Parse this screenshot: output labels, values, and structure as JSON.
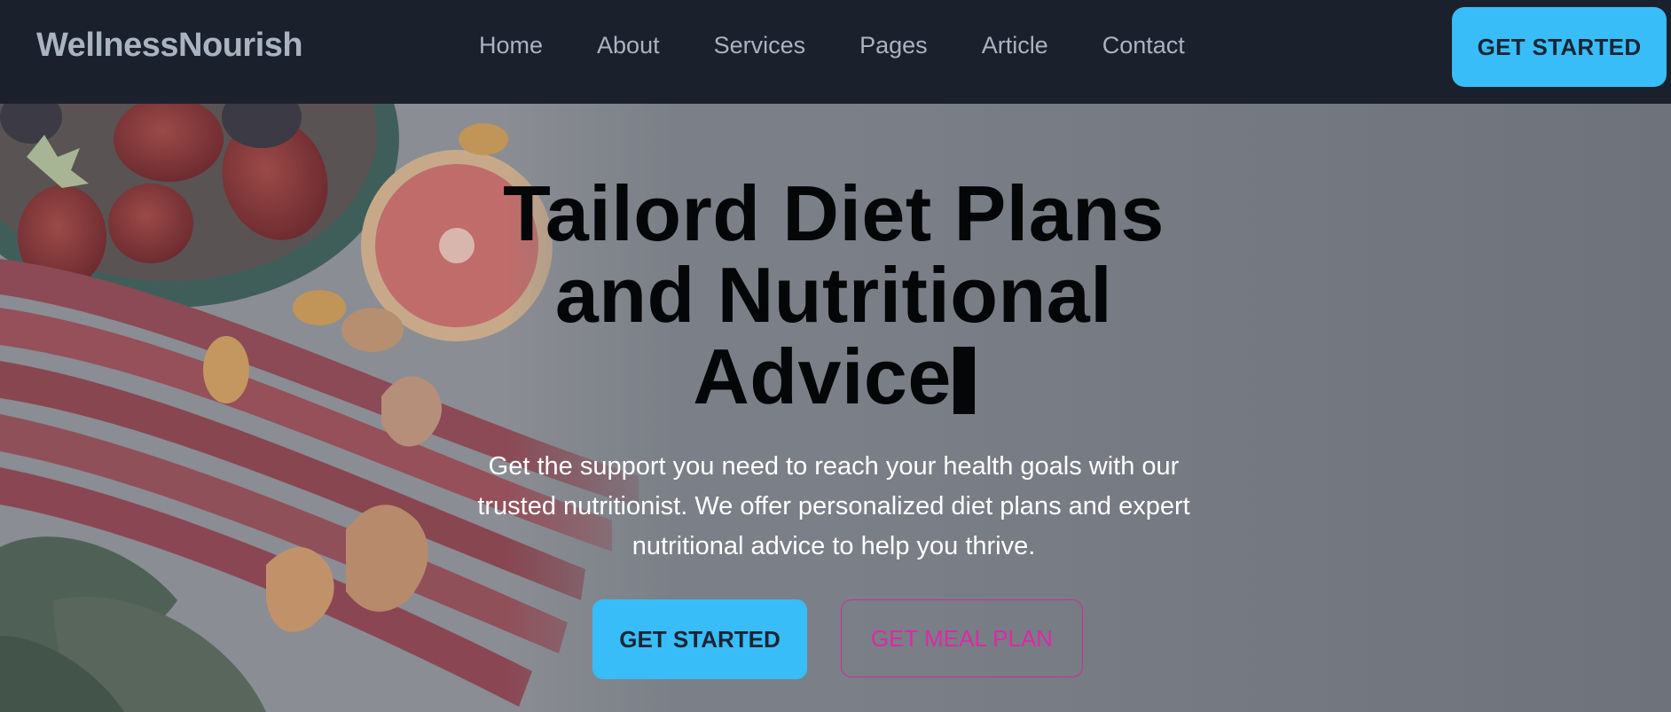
{
  "header": {
    "logo": "WellnessNourish",
    "nav": [
      {
        "label": "Home"
      },
      {
        "label": "About"
      },
      {
        "label": "Services"
      },
      {
        "label": "Pages"
      },
      {
        "label": "Article"
      },
      {
        "label": "Contact"
      }
    ],
    "cta_label": "GET STARTED"
  },
  "hero": {
    "title": "Tailord Diet Plans and Nutritional Advice",
    "subtitle": "Get the support you need to reach your health goals with our trusted nutritionist. We offer personalized diet plans and expert nutritional advice to help you thrive.",
    "primary_button": "GET STARTED",
    "secondary_button": "GET MEAL PLAN"
  },
  "colors": {
    "nav_bg": "#1b212c",
    "nav_text": "#a9b3c1",
    "accent": "#38bdf8",
    "secondary_accent": "#db2aa6",
    "hero_overlay": "#7b7f87"
  },
  "icons": {
    "text_cursor": "text-cursor-block"
  }
}
